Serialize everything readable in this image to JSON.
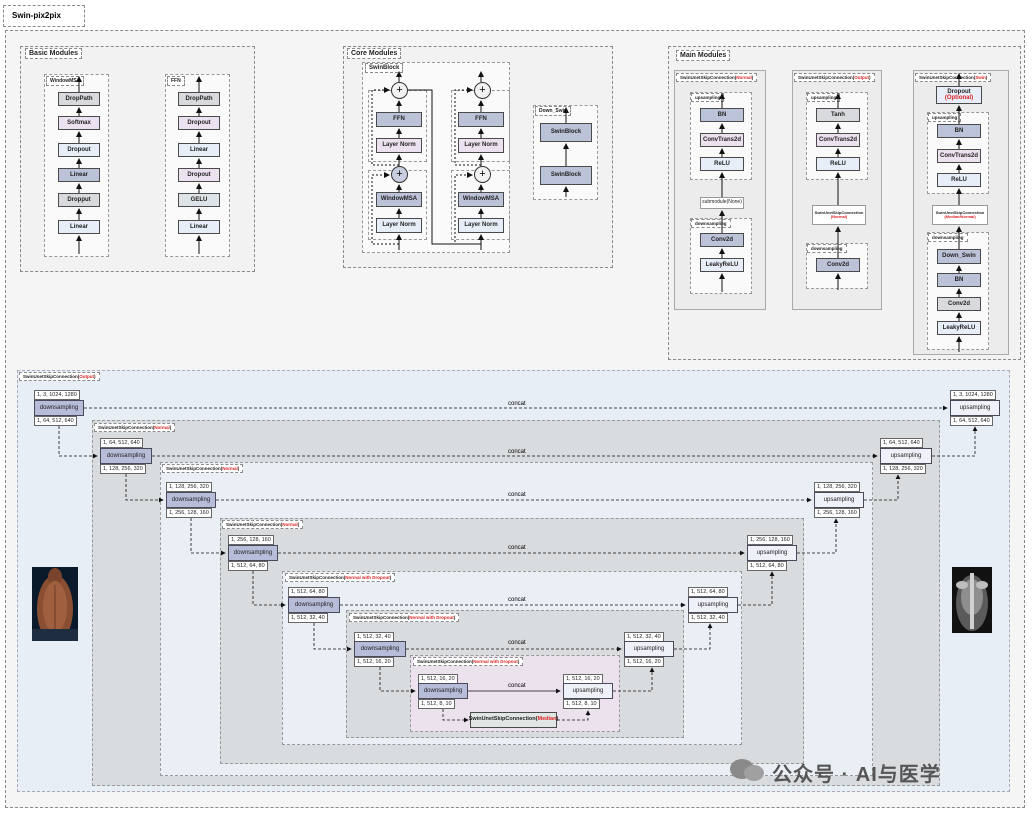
{
  "page_title": "Swin-pix2pix",
  "basic": {
    "title": "Basic Modules",
    "windowmsa": {
      "title": "WindowMSA",
      "blocks": [
        "DropPath",
        "Softmax",
        "Dropout",
        "Linear",
        "Dropput",
        "Linear"
      ]
    },
    "ffn": {
      "title": "FFN",
      "blocks": [
        "DropPath",
        "Dropout",
        "Linear",
        "Dropout",
        "GELU",
        "Linear"
      ]
    }
  },
  "core": {
    "title": "Core Modules",
    "swinblock": {
      "title": "SwinBlock",
      "plus": "+",
      "blocks": [
        "FFN",
        "Layer Norm",
        "WindowMSA",
        "Layer Norm"
      ]
    },
    "downswin": {
      "title": "Down_Swin",
      "blocks": [
        "SwinBlock",
        "SwinBlock"
      ]
    }
  },
  "main": {
    "title": "Main Modules",
    "normal": {
      "title_prefix": "SwinUnetSkipConnection(",
      "title_red": "Normal",
      "title_suffix": ")",
      "upsampling_tag": "upsampling",
      "up_blocks": [
        "BN",
        "ConvTrans2d",
        "ReLU"
      ],
      "submodule": "submodule(None)",
      "downsampling_tag": "downsampling",
      "down_blocks": [
        "Conv2d",
        "LeakyReLU"
      ]
    },
    "output": {
      "title_prefix": "SwinUnetSkipConnection(",
      "title_red": "Output",
      "title_suffix": ")",
      "upsampling_tag": "upsampling",
      "up_blocks": [
        "Tanh",
        "ConvTrans2d",
        "ReLU"
      ],
      "sub_title": "SwinUnetSkipConnection",
      "sub_red": "(Normal)",
      "downsampling_tag": "downsampling",
      "down_blocks": [
        "Conv2d"
      ]
    },
    "swin": {
      "title_prefix": "SwinUnetSkipConnection(",
      "title_red": "Swin",
      "title_suffix": ")",
      "dropout": "Dropout",
      "dropout_opt": "(Optional)",
      "upsampling_tag": "upsampling",
      "up_blocks": [
        "BN",
        "ConvTrans2d",
        "ReLU"
      ],
      "sub_title": "SwinUnetSkipConnection",
      "sub_red": "(Median/Normal)",
      "downsampling_tag": "downsampling",
      "down_blocks": [
        "Down_Swin",
        "BN",
        "Conv2d",
        "LeakyReLU"
      ]
    }
  },
  "bottom": {
    "down_label": "downsampling",
    "up_label": "upsampling",
    "concat": "concat",
    "levels": [
      {
        "prefix": "SwinUnetSkipConnection(",
        "red": "Output",
        "suffix": ")",
        "in": "1, 3, 1024, 1280",
        "out": "1, 64, 512, 640",
        "up_in": "1, 3, 1024, 1280",
        "up_out": "1, 64, 512, 640"
      },
      {
        "prefix": "SwinUnetSkipConnection(",
        "red": "Normal",
        "suffix": ")",
        "in": "1, 64, 512, 640",
        "out": "1, 128, 256, 320",
        "up_in": "1, 64, 512, 640",
        "up_out": "1, 128, 256, 320"
      },
      {
        "prefix": "SwinUnetSkipConnection(",
        "red": "Normal",
        "suffix": ")",
        "in": "1, 128, 256, 320",
        "out": "1, 256, 128, 160",
        "up_in": "1, 128, 256, 320",
        "up_out": "1, 256, 128, 160"
      },
      {
        "prefix": "SwinUnetSkipConnection(",
        "red": "Normal",
        "suffix": ")",
        "in": "1, 256, 128, 160",
        "out": "1, 512, 64, 80",
        "up_in": "1, 256, 128, 160",
        "up_out": "1, 512, 64, 80"
      },
      {
        "prefix": "SwinUnetSkipConnection(",
        "red": "Normal with Dropout",
        "suffix": ")",
        "in": "1, 512, 64, 80",
        "out": "1, 512, 32, 40",
        "up_in": "1, 512, 64, 80",
        "up_out": "1, 512, 32, 40"
      },
      {
        "prefix": "SwinUnetSkipConnection(",
        "red": "Normal with Dropout",
        "suffix": ")",
        "in": "1, 512, 32, 40",
        "out": "1, 512, 16, 20",
        "up_in": "1, 512, 32, 40",
        "up_out": "1, 512, 16, 20"
      },
      {
        "prefix": "SwinUnetSkipConnection(",
        "red": "Normal with Dropout",
        "suffix": ")",
        "in": "1, 512, 16, 20",
        "out": "1, 512, 8, 10",
        "up_in": "1, 512, 16, 20",
        "up_out": "1, 512, 8, 10"
      }
    ],
    "median_prefix": "SwinUnetSkipConnection(",
    "median_red": "Median",
    "median_suffix": ")"
  },
  "watermark": "公众号 · AI与医学"
}
